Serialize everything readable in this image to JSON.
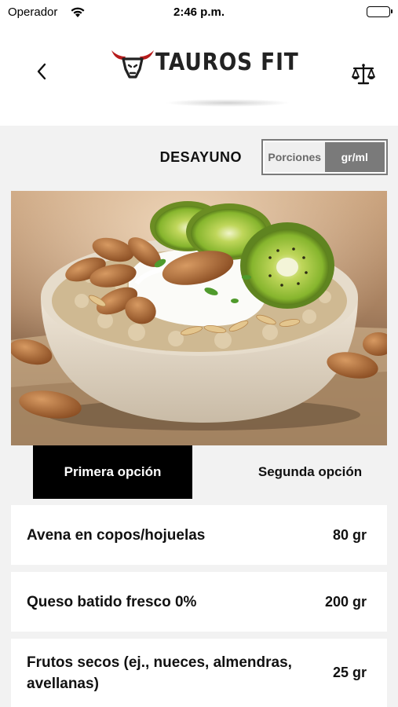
{
  "status_bar": {
    "carrier": "Operador",
    "time": "2:46 p.m."
  },
  "header": {
    "brand": "TAUROS FIT",
    "back_icon": "chevron-left-icon",
    "scale_icon": "balance-scale-icon"
  },
  "meal": {
    "title": "DESAYUNO",
    "unit_toggle": {
      "options": [
        "Porciones",
        "gr/ml"
      ],
      "selected": "gr/ml"
    }
  },
  "options": {
    "tabs": [
      "Primera opción",
      "Segunda opción"
    ],
    "selected": "Primera opción"
  },
  "ingredients": [
    {
      "name": "Avena en copos/hojuelas",
      "qty": "80 gr"
    },
    {
      "name": "Queso batido fresco 0%",
      "qty": "200 gr"
    },
    {
      "name": "Frutos secos (ej., nueces, almendras, avellanas)",
      "qty": "25 gr"
    }
  ],
  "colors": {
    "brand_red": "#b71c1c",
    "toggle_active": "#7a7a7a",
    "tab_active": "#000000"
  }
}
